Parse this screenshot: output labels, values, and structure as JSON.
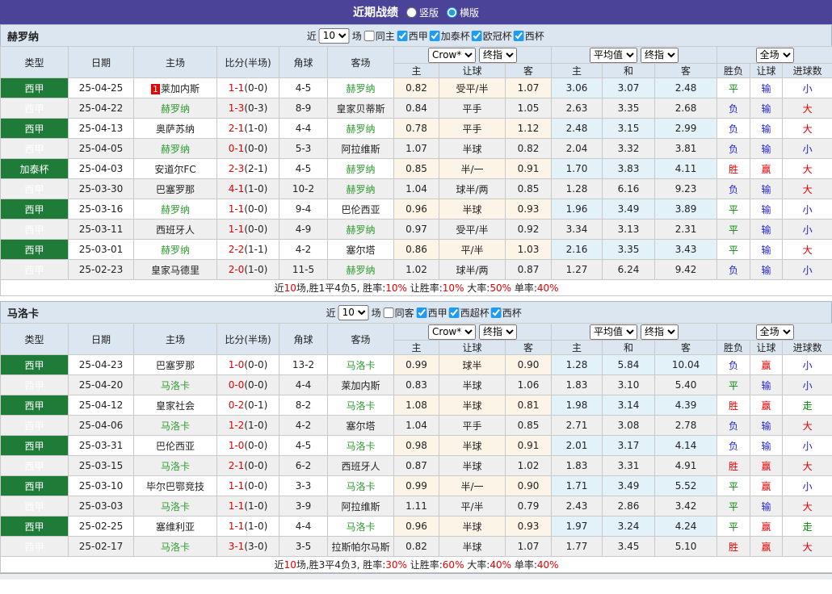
{
  "title_bar": {
    "title": "近期战绩",
    "layout_options": [
      "竖版",
      "横版"
    ],
    "selected_layout": "横版"
  },
  "colors": {
    "purple": "#4b4397",
    "band": "#dce6f1",
    "typegreen": "#1e7c38",
    "teamgreen": "#2e9b2e",
    "red": "#e60000",
    "green": "#008800",
    "blue": "#2323cc",
    "cream": "#fcf4e6",
    "lblue": "#e3f1f9",
    "accent": "#1f9bef"
  },
  "columns": {
    "type": "类型",
    "date": "日期",
    "home": "主场",
    "score": "比分(半场)",
    "corner": "角球",
    "away": "客场",
    "odds_source": "Crow*",
    "odds_time": "终指",
    "home_win": "主",
    "handicap": "让球",
    "away_win": "客",
    "avg_source": "平均值",
    "avg_time": "终指",
    "avg_home": "主",
    "avg_draw": "和",
    "avg_away": "客",
    "scope": "全场",
    "result": "胜负",
    "handicap_result": "让球",
    "goals": "进球数"
  },
  "sections": [
    {
      "team": "赫罗纳",
      "filter": {
        "near": "近",
        "count": "10",
        "games": "场",
        "same": "同主",
        "leagues": [
          "西甲",
          "加泰杯",
          "欧冠杯",
          "西杯"
        ]
      },
      "rows": [
        {
          "league": "西甲",
          "date": "25-04-25",
          "home": "莱加内斯",
          "home_badge": "1",
          "home_team": false,
          "score": "1-1",
          "half": "(0-0)",
          "corners": "4-5",
          "away": "赫罗纳",
          "away_team": true,
          "odds": [
            "0.82",
            "受平/半",
            "1.07"
          ],
          "avg": [
            "3.06",
            "3.07",
            "2.48"
          ],
          "result": [
            "平",
            "g"
          ],
          "hresult": [
            "输",
            "b"
          ],
          "goals": [
            "小",
            "b"
          ]
        },
        {
          "league": "西甲",
          "date": "25-04-22",
          "home": "赫罗纳",
          "home_badge": "",
          "home_team": true,
          "score": "1-3",
          "half": "(0-3)",
          "corners": "8-9",
          "away": "皇家贝蒂斯",
          "away_team": false,
          "odds": [
            "0.84",
            "平手",
            "1.05"
          ],
          "avg": [
            "2.63",
            "3.35",
            "2.68"
          ],
          "result": [
            "负",
            "b"
          ],
          "hresult": [
            "输",
            "b"
          ],
          "goals": [
            "大",
            "r"
          ]
        },
        {
          "league": "西甲",
          "date": "25-04-13",
          "home": "奥萨苏纳",
          "home_badge": "",
          "home_team": false,
          "score": "2-1",
          "half": "(1-0)",
          "corners": "4-4",
          "away": "赫罗纳",
          "away_team": true,
          "odds": [
            "0.78",
            "平手",
            "1.12"
          ],
          "avg": [
            "2.48",
            "3.15",
            "2.99"
          ],
          "result": [
            "负",
            "b"
          ],
          "hresult": [
            "输",
            "b"
          ],
          "goals": [
            "大",
            "r"
          ]
        },
        {
          "league": "西甲",
          "date": "25-04-05",
          "home": "赫罗纳",
          "home_badge": "",
          "home_team": true,
          "score": "0-1",
          "half": "(0-0)",
          "corners": "5-3",
          "away": "阿拉维斯",
          "away_team": false,
          "odds": [
            "1.07",
            "半球",
            "0.82"
          ],
          "avg": [
            "2.04",
            "3.32",
            "3.81"
          ],
          "result": [
            "负",
            "b"
          ],
          "hresult": [
            "输",
            "b"
          ],
          "goals": [
            "小",
            "b"
          ]
        },
        {
          "league": "加泰杯",
          "date": "25-04-03",
          "home": "安道尔FC",
          "home_badge": "",
          "home_team": false,
          "score": "2-3",
          "half": "(2-1)",
          "corners": "4-5",
          "away": "赫罗纳",
          "away_team": true,
          "odds": [
            "0.85",
            "半/一",
            "0.91"
          ],
          "avg": [
            "1.70",
            "3.83",
            "4.11"
          ],
          "result": [
            "胜",
            "r"
          ],
          "hresult": [
            "赢",
            "r"
          ],
          "goals": [
            "大",
            "r"
          ]
        },
        {
          "league": "西甲",
          "date": "25-03-30",
          "home": "巴塞罗那",
          "home_badge": "",
          "home_team": false,
          "score": "4-1",
          "half": "(1-0)",
          "corners": "10-2",
          "away": "赫罗纳",
          "away_team": true,
          "odds": [
            "1.04",
            "球半/两",
            "0.85"
          ],
          "avg": [
            "1.28",
            "6.16",
            "9.23"
          ],
          "result": [
            "负",
            "b"
          ],
          "hresult": [
            "输",
            "b"
          ],
          "goals": [
            "大",
            "r"
          ]
        },
        {
          "league": "西甲",
          "date": "25-03-16",
          "home": "赫罗纳",
          "home_badge": "",
          "home_team": true,
          "score": "1-1",
          "half": "(0-0)",
          "corners": "9-4",
          "away": "巴伦西亚",
          "away_team": false,
          "odds": [
            "0.96",
            "半球",
            "0.93"
          ],
          "avg": [
            "1.96",
            "3.49",
            "3.89"
          ],
          "result": [
            "平",
            "g"
          ],
          "hresult": [
            "输",
            "b"
          ],
          "goals": [
            "小",
            "b"
          ]
        },
        {
          "league": "西甲",
          "date": "25-03-11",
          "home": "西班牙人",
          "home_badge": "",
          "home_team": false,
          "score": "1-1",
          "half": "(0-0)",
          "corners": "4-9",
          "away": "赫罗纳",
          "away_team": true,
          "odds": [
            "0.97",
            "受平/半",
            "0.92"
          ],
          "avg": [
            "3.34",
            "3.13",
            "2.31"
          ],
          "result": [
            "平",
            "g"
          ],
          "hresult": [
            "输",
            "b"
          ],
          "goals": [
            "小",
            "b"
          ]
        },
        {
          "league": "西甲",
          "date": "25-03-01",
          "home": "赫罗纳",
          "home_badge": "",
          "home_team": true,
          "score": "2-2",
          "half": "(1-1)",
          "corners": "4-2",
          "away": "塞尔塔",
          "away_team": false,
          "odds": [
            "0.86",
            "平/半",
            "1.03"
          ],
          "avg": [
            "2.16",
            "3.35",
            "3.43"
          ],
          "result": [
            "平",
            "g"
          ],
          "hresult": [
            "输",
            "b"
          ],
          "goals": [
            "大",
            "r"
          ]
        },
        {
          "league": "西甲",
          "date": "25-02-23",
          "home": "皇家马德里",
          "home_badge": "",
          "home_team": false,
          "score": "2-0",
          "half": "(1-0)",
          "corners": "11-5",
          "away": "赫罗纳",
          "away_team": true,
          "odds": [
            "1.02",
            "球半/两",
            "0.87"
          ],
          "avg": [
            "1.27",
            "6.24",
            "9.42"
          ],
          "result": [
            "负",
            "b"
          ],
          "hresult": [
            "输",
            "b"
          ],
          "goals": [
            "小",
            "b"
          ]
        }
      ],
      "summary": [
        [
          "近",
          "k"
        ],
        [
          "10",
          "r"
        ],
        [
          "场,胜1平4负5, 胜率:",
          "k"
        ],
        [
          "10%",
          "r"
        ],
        [
          " 让胜率:",
          "k"
        ],
        [
          "10%",
          "r"
        ],
        [
          " 大率:",
          "k"
        ],
        [
          "50%",
          "r"
        ],
        [
          " 单率:",
          "k"
        ],
        [
          "40%",
          "r"
        ]
      ]
    },
    {
      "team": "马洛卡",
      "filter": {
        "near": "近",
        "count": "10",
        "games": "场",
        "same": "同客",
        "leagues": [
          "西甲",
          "西超杯",
          "西杯"
        ]
      },
      "rows": [
        {
          "league": "西甲",
          "date": "25-04-23",
          "home": "巴塞罗那",
          "home_badge": "",
          "home_team": false,
          "score": "1-0",
          "half": "(0-0)",
          "corners": "13-2",
          "away": "马洛卡",
          "away_team": true,
          "odds": [
            "0.99",
            "球半",
            "0.90"
          ],
          "avg": [
            "1.28",
            "5.84",
            "10.04"
          ],
          "result": [
            "负",
            "b"
          ],
          "hresult": [
            "赢",
            "r"
          ],
          "goals": [
            "小",
            "b"
          ]
        },
        {
          "league": "西甲",
          "date": "25-04-20",
          "home": "马洛卡",
          "home_badge": "",
          "home_team": true,
          "score": "0-0",
          "half": "(0-0)",
          "corners": "4-4",
          "away": "莱加内斯",
          "away_team": false,
          "odds": [
            "0.83",
            "半球",
            "1.06"
          ],
          "avg": [
            "1.83",
            "3.10",
            "5.40"
          ],
          "result": [
            "平",
            "g"
          ],
          "hresult": [
            "输",
            "b"
          ],
          "goals": [
            "小",
            "b"
          ]
        },
        {
          "league": "西甲",
          "date": "25-04-12",
          "home": "皇家社会",
          "home_badge": "",
          "home_team": false,
          "score": "0-2",
          "half": "(0-1)",
          "corners": "8-2",
          "away": "马洛卡",
          "away_team": true,
          "odds": [
            "1.08",
            "半球",
            "0.81"
          ],
          "avg": [
            "1.98",
            "3.14",
            "4.39"
          ],
          "result": [
            "胜",
            "r"
          ],
          "hresult": [
            "赢",
            "r"
          ],
          "goals": [
            "走",
            "g"
          ]
        },
        {
          "league": "西甲",
          "date": "25-04-06",
          "home": "马洛卡",
          "home_badge": "",
          "home_team": true,
          "score": "1-2",
          "half": "(1-0)",
          "corners": "4-2",
          "away": "塞尔塔",
          "away_team": false,
          "odds": [
            "1.04",
            "平手",
            "0.85"
          ],
          "avg": [
            "2.71",
            "3.08",
            "2.78"
          ],
          "result": [
            "负",
            "b"
          ],
          "hresult": [
            "输",
            "b"
          ],
          "goals": [
            "大",
            "r"
          ]
        },
        {
          "league": "西甲",
          "date": "25-03-31",
          "home": "巴伦西亚",
          "home_badge": "",
          "home_team": false,
          "score": "1-0",
          "half": "(0-0)",
          "corners": "4-5",
          "away": "马洛卡",
          "away_team": true,
          "odds": [
            "0.98",
            "半球",
            "0.91"
          ],
          "avg": [
            "2.01",
            "3.17",
            "4.14"
          ],
          "result": [
            "负",
            "b"
          ],
          "hresult": [
            "输",
            "b"
          ],
          "goals": [
            "小",
            "b"
          ]
        },
        {
          "league": "西甲",
          "date": "25-03-15",
          "home": "马洛卡",
          "home_badge": "",
          "home_team": true,
          "score": "2-1",
          "half": "(0-0)",
          "corners": "6-2",
          "away": "西班牙人",
          "away_team": false,
          "odds": [
            "0.87",
            "半球",
            "1.02"
          ],
          "avg": [
            "1.83",
            "3.31",
            "4.91"
          ],
          "result": [
            "胜",
            "r"
          ],
          "hresult": [
            "赢",
            "r"
          ],
          "goals": [
            "大",
            "r"
          ]
        },
        {
          "league": "西甲",
          "date": "25-03-10",
          "home": "毕尔巴鄂竞技",
          "home_badge": "",
          "home_team": false,
          "score": "1-1",
          "half": "(0-0)",
          "corners": "3-3",
          "away": "马洛卡",
          "away_team": true,
          "odds": [
            "0.99",
            "半/一",
            "0.90"
          ],
          "avg": [
            "1.71",
            "3.49",
            "5.52"
          ],
          "result": [
            "平",
            "g"
          ],
          "hresult": [
            "赢",
            "r"
          ],
          "goals": [
            "小",
            "b"
          ]
        },
        {
          "league": "西甲",
          "date": "25-03-03",
          "home": "马洛卡",
          "home_badge": "",
          "home_team": true,
          "score": "1-1",
          "half": "(1-0)",
          "corners": "3-9",
          "away": "阿拉维斯",
          "away_team": false,
          "odds": [
            "1.11",
            "平/半",
            "0.79"
          ],
          "avg": [
            "2.43",
            "2.86",
            "3.42"
          ],
          "result": [
            "平",
            "g"
          ],
          "hresult": [
            "输",
            "b"
          ],
          "goals": [
            "大",
            "r"
          ]
        },
        {
          "league": "西甲",
          "date": "25-02-25",
          "home": "塞维利亚",
          "home_badge": "",
          "home_team": false,
          "score": "1-1",
          "half": "(1-0)",
          "corners": "4-4",
          "away": "马洛卡",
          "away_team": true,
          "odds": [
            "0.96",
            "半球",
            "0.93"
          ],
          "avg": [
            "1.97",
            "3.24",
            "4.24"
          ],
          "result": [
            "平",
            "g"
          ],
          "hresult": [
            "赢",
            "r"
          ],
          "goals": [
            "走",
            "g"
          ]
        },
        {
          "league": "西甲",
          "date": "25-02-17",
          "home": "马洛卡",
          "home_badge": "",
          "home_team": true,
          "score": "3-1",
          "half": "(3-0)",
          "corners": "3-5",
          "away": "拉斯帕尔马斯",
          "away_team": false,
          "odds": [
            "0.82",
            "半球",
            "1.07"
          ],
          "avg": [
            "1.77",
            "3.45",
            "5.10"
          ],
          "result": [
            "胜",
            "r"
          ],
          "hresult": [
            "赢",
            "r"
          ],
          "goals": [
            "大",
            "r"
          ]
        }
      ],
      "summary": [
        [
          "近",
          "k"
        ],
        [
          "10",
          "r"
        ],
        [
          "场,胜3平4负3, 胜率:",
          "k"
        ],
        [
          "30%",
          "r"
        ],
        [
          " 让胜率:",
          "k"
        ],
        [
          "60%",
          "r"
        ],
        [
          " 大率:",
          "k"
        ],
        [
          "40%",
          "r"
        ],
        [
          " 单率:",
          "k"
        ],
        [
          "40%",
          "r"
        ]
      ]
    }
  ]
}
